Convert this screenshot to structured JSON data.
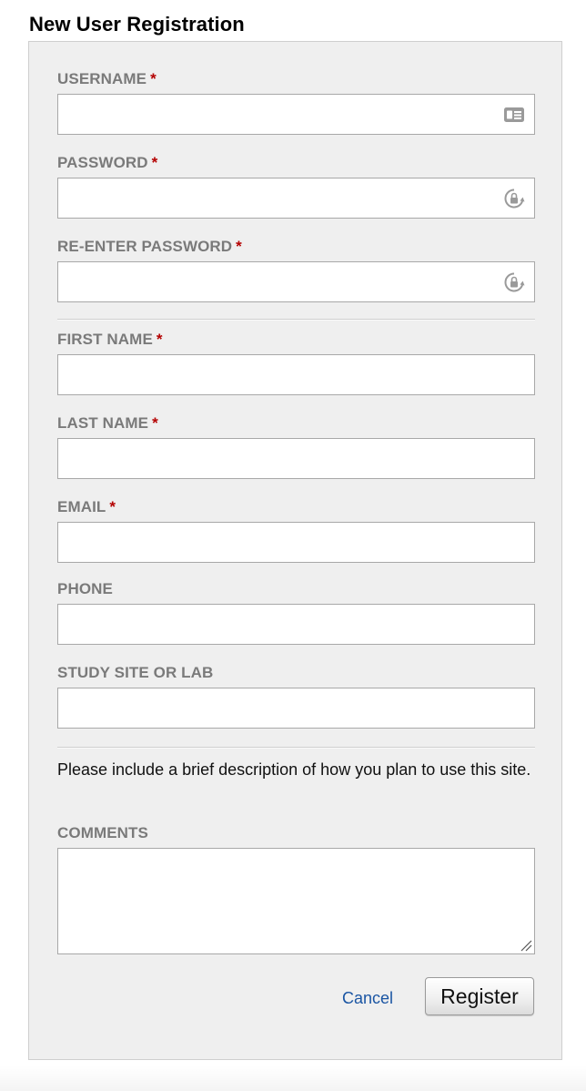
{
  "page": {
    "title": "New User Registration"
  },
  "form": {
    "required_marker": "*",
    "fields": {
      "username": {
        "label": "USERNAME",
        "value": "",
        "icon": "contact-card-icon"
      },
      "password": {
        "label": "PASSWORD",
        "value": "",
        "icon": "password-lock-icon"
      },
      "reenter_password": {
        "label": "RE-ENTER PASSWORD",
        "value": "",
        "icon": "password-lock-icon"
      },
      "first_name": {
        "label": "FIRST NAME",
        "value": ""
      },
      "last_name": {
        "label": "LAST NAME",
        "value": ""
      },
      "email": {
        "label": "EMAIL",
        "value": ""
      },
      "phone": {
        "label": "PHONE",
        "value": ""
      },
      "study_site": {
        "label": "STUDY SITE OR LAB",
        "value": ""
      },
      "comments": {
        "label": "COMMENTS",
        "value": ""
      }
    },
    "note": "Please include a brief description of how you plan to use this site.",
    "actions": {
      "cancel_label": "Cancel",
      "register_label": "Register"
    }
  },
  "colors": {
    "label": "#7a7a7a",
    "required": "#b40000",
    "link": "#1a55a3",
    "panel_bg": "#efefef"
  }
}
